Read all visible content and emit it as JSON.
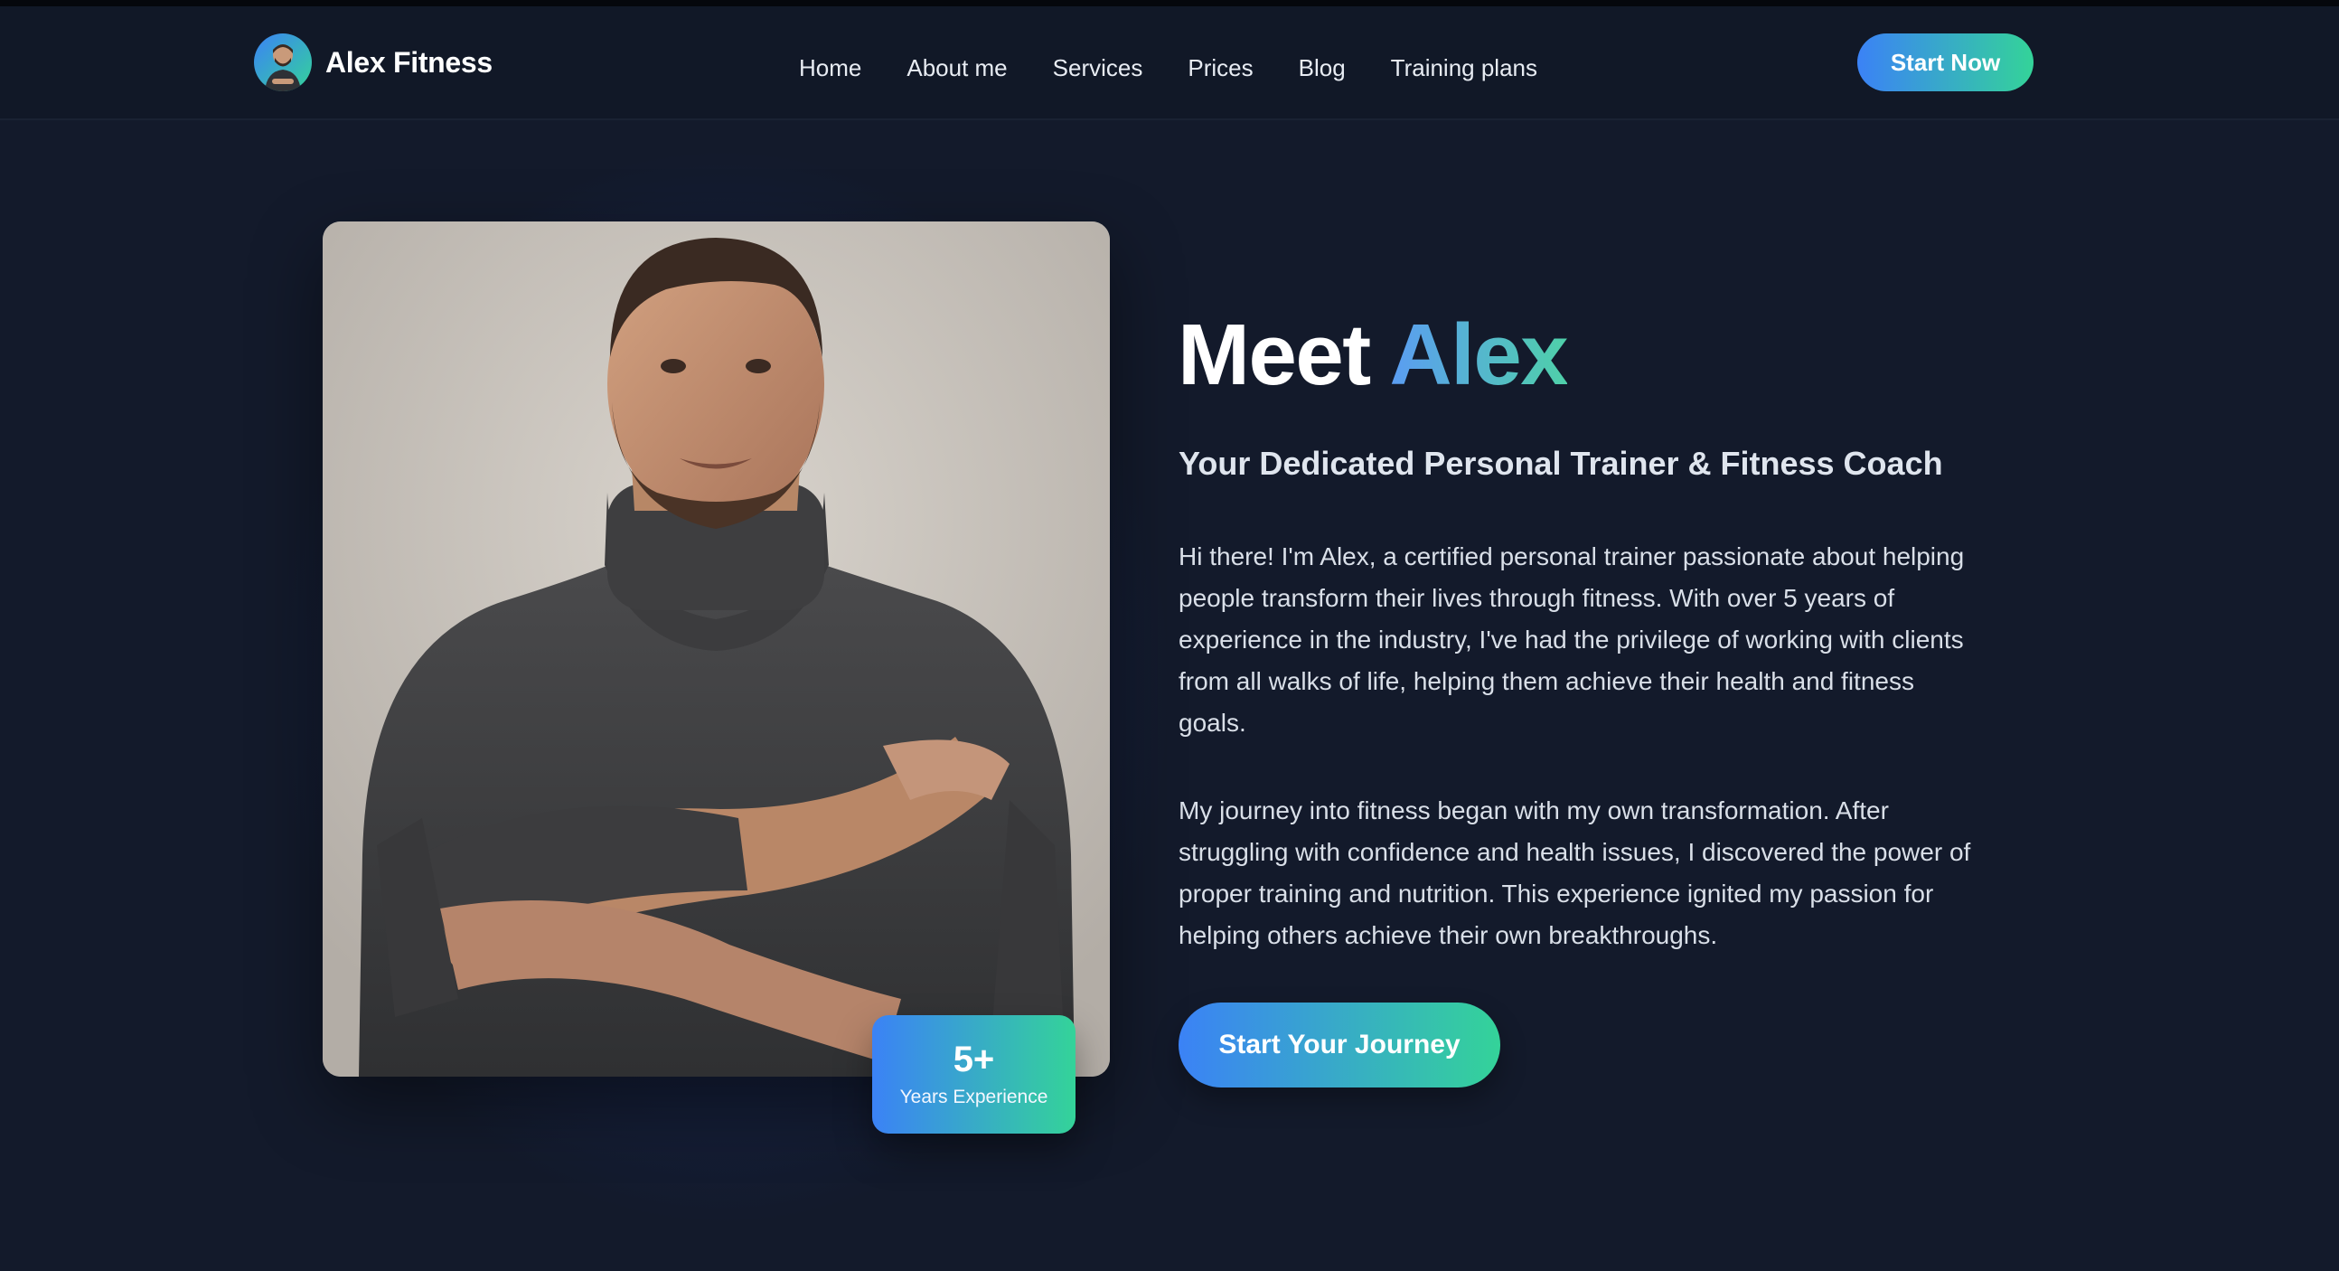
{
  "brand": {
    "name": "Alex Fitness",
    "avatar_icon": "trainer-avatar-icon"
  },
  "nav": {
    "items": [
      {
        "label": "Home"
      },
      {
        "label": "About me"
      },
      {
        "label": "Services"
      },
      {
        "label": "Prices"
      },
      {
        "label": "Blog"
      },
      {
        "label": "Training plans"
      }
    ],
    "cta_label": "Start Now"
  },
  "hero": {
    "headline_prefix": "Meet",
    "headline_name": "Alex",
    "subtitle": "Your Dedicated Personal Trainer & Fitness Coach",
    "paragraphs": [
      "Hi there! I'm Alex, a certified personal trainer passionate about helping people transform their lives through fitness. With over 5 years of experience in the industry, I've had the privilege of working with clients from all walks of life, helping them achieve their health and fitness goals.",
      "My journey into fitness began with my own transformation. After struggling with confidence and health issues, I discovered the power of proper training and nutrition. This experience ignited my passion for helping others achieve their own breakthroughs."
    ],
    "cta_label": "Start Your Journey",
    "photo_alt": "trainer-portrait",
    "badge": {
      "value": "5+",
      "label": "Years Experience"
    }
  },
  "colors": {
    "background": "#131a2b",
    "nav_background": "#111827",
    "gradient_start": "#3b82f6",
    "gradient_end": "#34d399",
    "text": "#ffffff"
  }
}
